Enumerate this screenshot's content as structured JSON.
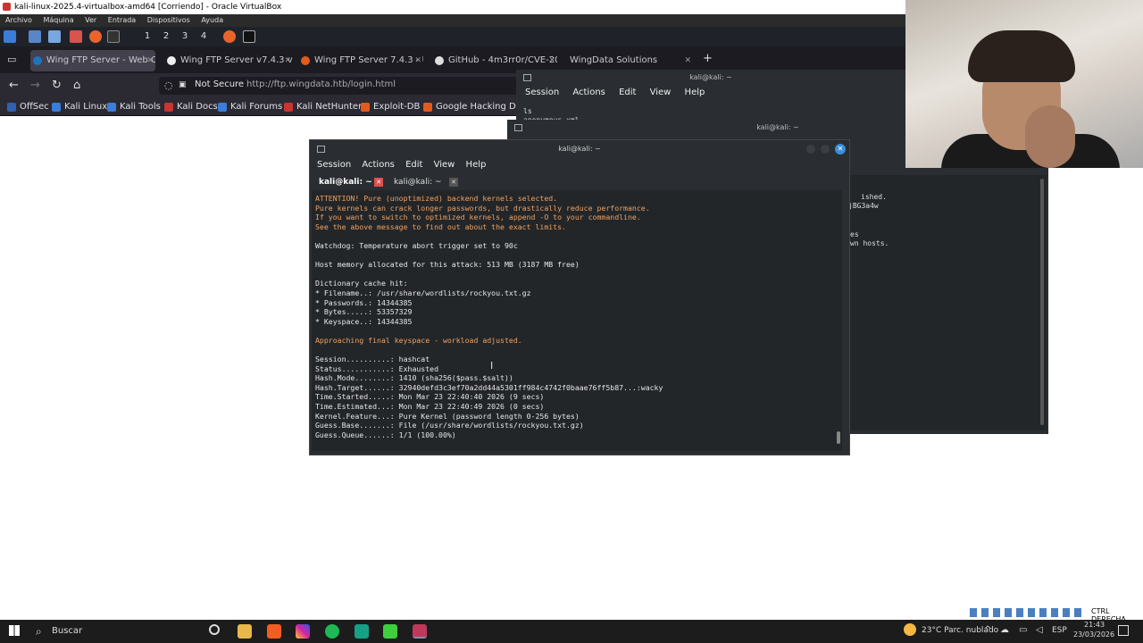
{
  "vbox": {
    "title": "kali-linux-2025.4-virtualbox-amd64 [Corriendo] - Oracle VirtualBox",
    "menu": [
      "Archivo",
      "Máquina",
      "Ver",
      "Entrada",
      "Dispositivos",
      "Ayuda"
    ]
  },
  "kali_panel": {
    "workspaces": [
      "1",
      "2",
      "3",
      "4"
    ]
  },
  "browser": {
    "tabs": [
      {
        "label": "Wing FTP Server - Web C"
      },
      {
        "label": "Wing FTP Server v7.4.3 v"
      },
      {
        "label": "Wing FTP Server 7.4.3 - U"
      },
      {
        "label": "GitHub - 4m3rr0r/CVE-20"
      },
      {
        "label": "WingData Solutions"
      }
    ],
    "new_tab": "+",
    "not_secure": "Not Secure",
    "url": "http://ftp.wingdata.htb/login.html",
    "bookmarks": [
      "OffSec",
      "Kali Linux",
      "Kali Tools",
      "Kali Docs",
      "Kali Forums",
      "Kali NetHunter",
      "Exploit-DB",
      "Google Hacking DB"
    ]
  },
  "term_back": {
    "title": "kali@kali: ~",
    "menu": [
      "Session",
      "Actions",
      "Edit",
      "View",
      "Help"
    ],
    "lines": [
      "ls",
      "anonymous.xml"
    ]
  },
  "term_mid": {
    "title": "kali@kali: ~",
    "fragments": [
      "ished.",
      "jBG3a4w",
      "es",
      "wn hosts."
    ]
  },
  "term_main": {
    "title": "kali@kali: ~",
    "menu": [
      "Session",
      "Actions",
      "Edit",
      "View",
      "Help"
    ],
    "tabs": [
      "kali@kali: ~",
      "kali@kali: ~"
    ],
    "lines": [
      {
        "t": "ATTENTION! Pure (unoptimized) backend kernels selected.",
        "c": "orange"
      },
      {
        "t": "Pure kernels can crack longer passwords, but drastically reduce performance.",
        "c": "orange"
      },
      {
        "t": "If you want to switch to optimized kernels, append -O to your commandline.",
        "c": "orange"
      },
      {
        "t": "See the above message to find out about the exact limits.",
        "c": "orange"
      },
      {
        "t": "",
        "c": "white"
      },
      {
        "t": "Watchdog: Temperature abort trigger set to 90c",
        "c": "white"
      },
      {
        "t": "",
        "c": "white"
      },
      {
        "t": "Host memory allocated for this attack: 513 MB (3187 MB free)",
        "c": "white"
      },
      {
        "t": "",
        "c": "white"
      },
      {
        "t": "Dictionary cache hit:",
        "c": "white"
      },
      {
        "t": "* Filename..: /usr/share/wordlists/rockyou.txt.gz",
        "c": "white"
      },
      {
        "t": "* Passwords.: 14344385",
        "c": "white"
      },
      {
        "t": "* Bytes.....: 53357329",
        "c": "white"
      },
      {
        "t": "* Keyspace..: 14344385",
        "c": "white"
      },
      {
        "t": "",
        "c": "white"
      },
      {
        "t": "Approaching final keyspace - workload adjusted.",
        "c": "orange"
      },
      {
        "t": "",
        "c": "white"
      },
      {
        "t": "Session..........: hashcat",
        "c": "white"
      },
      {
        "t": "Status...........: Exhausted",
        "c": "white"
      },
      {
        "t": "Hash.Mode........: 1410 (sha256($pass.$salt))",
        "c": "white"
      },
      {
        "t": "Hash.Target......: 32940defd3c3ef70a2dd44a5301ff984c4742f0baae76ff5b87...:wacky",
        "c": "white"
      },
      {
        "t": "Time.Started.....: Mon Mar 23 22:40:40 2026 (9 secs)",
        "c": "white"
      },
      {
        "t": "Time.Estimated...: Mon Mar 23 22:40:49 2026 (0 secs)",
        "c": "white"
      },
      {
        "t": "Kernel.Feature...: Pure Kernel (password length 0-256 bytes)",
        "c": "white"
      },
      {
        "t": "Guess.Base.......: File (/usr/share/wordlists/rockyou.txt.gz)",
        "c": "white"
      },
      {
        "t": "Guess.Queue......: 1/1 (100.00%)",
        "c": "white"
      }
    ]
  },
  "taskbar": {
    "search_placeholder": "Buscar",
    "weather": "23°C  Parc. nublado",
    "lang": "ESP",
    "time": "21:43",
    "date": "23/03/2026",
    "host_key": "CTRL DERECHA"
  },
  "colors": {
    "term_bg": "#232629",
    "orange": "#f0a060",
    "panel": "#1f2329"
  }
}
